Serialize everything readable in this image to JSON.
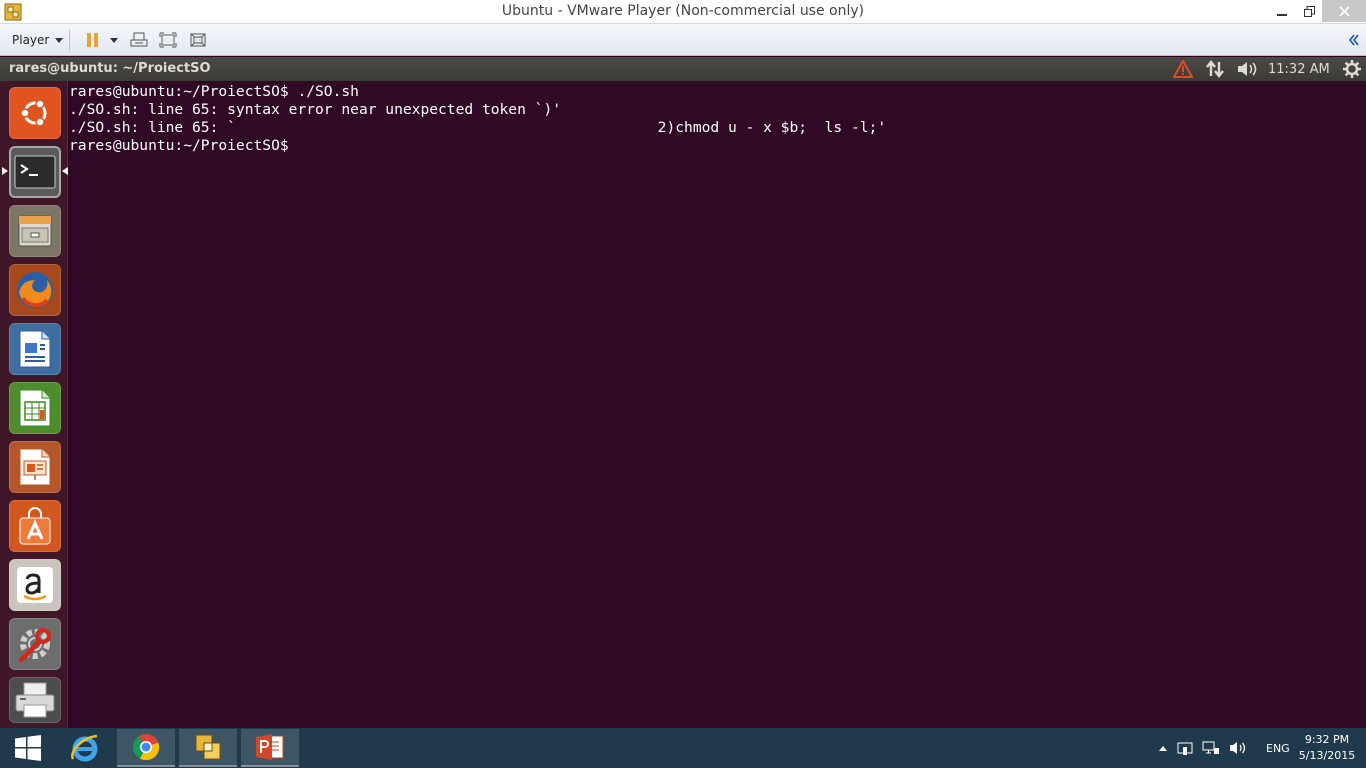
{
  "window": {
    "title": "Ubuntu  - VMware Player (Non-commercial use only)",
    "minimize_icon": "minimize-icon",
    "maximize_icon": "restore-icon",
    "close_icon": "close-icon"
  },
  "vmware_toolbar": {
    "player_menu_label": "Player",
    "buttons": [
      "pause-icon",
      "send-ctrl-alt-del-icon",
      "fullscreen-icon",
      "unity-icon",
      "collapse-icon"
    ]
  },
  "ubuntu_panel": {
    "window_title": "rares@ubuntu: ~/ProiectSO",
    "indicators": [
      "warning-icon",
      "network-icon",
      "volume-icon"
    ],
    "clock": "11:32 AM",
    "gear_icon": "session-gear-icon"
  },
  "launcher": {
    "items": [
      {
        "name": "dash-home",
        "icon": "ubuntu-logo-icon"
      },
      {
        "name": "terminal",
        "icon": "terminal-icon",
        "active": true
      },
      {
        "name": "files",
        "icon": "file-cabinet-icon"
      },
      {
        "name": "firefox",
        "icon": "firefox-icon"
      },
      {
        "name": "libreoffice-writer",
        "icon": "writer-icon"
      },
      {
        "name": "libreoffice-calc",
        "icon": "calc-icon"
      },
      {
        "name": "libreoffice-impress",
        "icon": "impress-icon"
      },
      {
        "name": "ubuntu-software-center",
        "icon": "shopping-bag-icon"
      },
      {
        "name": "amazon",
        "icon": "amazon-icon"
      },
      {
        "name": "system-settings",
        "icon": "wrench-gear-icon"
      },
      {
        "name": "printer",
        "icon": "printer-icon"
      }
    ]
  },
  "terminal": {
    "lines": [
      "rares@ubuntu:~/ProiectSO$ ./SO.sh",
      "./SO.sh: line 65: syntax error near unexpected token `)'",
      "./SO.sh: line 65: `                                                2)chmod u - x $b;  ls -l;'",
      "rares@ubuntu:~/ProiectSO$ "
    ]
  },
  "taskbar": {
    "start_icon": "windows-logo-icon",
    "apps": [
      {
        "name": "internet-explorer",
        "icon": "ie-icon",
        "running": false
      },
      {
        "name": "chrome",
        "icon": "chrome-icon",
        "running": true
      },
      {
        "name": "vmware-player",
        "icon": "vmware-icon",
        "running": true
      },
      {
        "name": "powerpoint",
        "icon": "powerpoint-icon",
        "running": true
      }
    ],
    "tray": {
      "show_hidden_icon": "chevron-up-icon",
      "icons": [
        "action-center-icon",
        "network-icon",
        "volume-icon"
      ],
      "language": "ENG",
      "time": "9:32 PM",
      "date": "5/13/2015"
    }
  }
}
